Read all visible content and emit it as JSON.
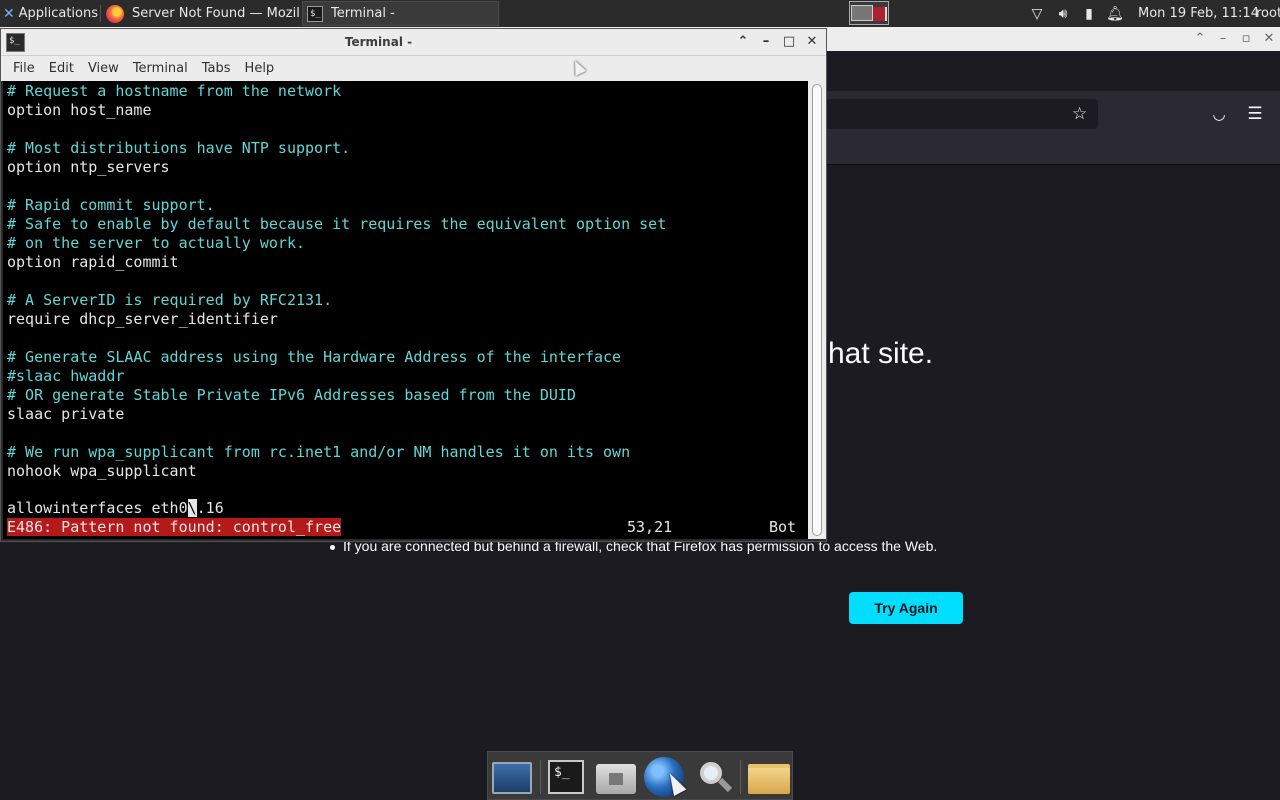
{
  "panel": {
    "apps_label": "Applications",
    "tasks": [
      {
        "label": "Server Not Found — Mozil..."
      },
      {
        "label": "Terminal -"
      }
    ],
    "clock": "Mon 19 Feb, 11:14",
    "user": "root"
  },
  "terminal": {
    "title": "Terminal -",
    "menu": [
      "File",
      "Edit",
      "View",
      "Terminal",
      "Tabs",
      "Help"
    ],
    "lines": [
      {
        "text": "# Request a hostname from the network",
        "kind": "c"
      },
      {
        "text": "option host_name",
        "kind": "w"
      },
      {
        "text": "",
        "kind": "w"
      },
      {
        "text": "# Most distributions have NTP support.",
        "kind": "c"
      },
      {
        "text": "option ntp_servers",
        "kind": "w"
      },
      {
        "text": "",
        "kind": "w"
      },
      {
        "text": "# Rapid commit support.",
        "kind": "c"
      },
      {
        "text": "# Safe to enable by default because it requires the equivalent option set",
        "kind": "c"
      },
      {
        "text": "# on the server to actually work.",
        "kind": "c"
      },
      {
        "text": "option rapid_commit",
        "kind": "w"
      },
      {
        "text": "",
        "kind": "w"
      },
      {
        "text": "# A ServerID is required by RFC2131.",
        "kind": "c"
      },
      {
        "text": "require dhcp_server_identifier",
        "kind": "w"
      },
      {
        "text": "",
        "kind": "w"
      },
      {
        "text": "# Generate SLAAC address using the Hardware Address of the interface",
        "kind": "c"
      },
      {
        "text": "#slaac hwaddr",
        "kind": "c"
      },
      {
        "text": "# OR generate Stable Private IPv6 Addresses based from the DUID",
        "kind": "c"
      },
      {
        "text": "slaac private",
        "kind": "w"
      },
      {
        "text": "",
        "kind": "w"
      },
      {
        "text": "# We run wpa_supplicant from rc.inet1 and/or NM handles it on its own",
        "kind": "c"
      },
      {
        "text": "nohook wpa_supplicant",
        "kind": "w"
      },
      {
        "text": "",
        "kind": "w"
      }
    ],
    "cursor_line": {
      "before": "allowinterfaces eth0",
      "cursor": "\\",
      "after": ".16"
    },
    "status": {
      "error": "E486: Pattern not found: control_free",
      "position": "53,21",
      "percent": "Bot"
    }
  },
  "firefox": {
    "heading": "hat site.",
    "bullet": "If you are connected but behind a firewall, check that Firefox has permission to access the Web.",
    "try_again": "Try Again"
  }
}
